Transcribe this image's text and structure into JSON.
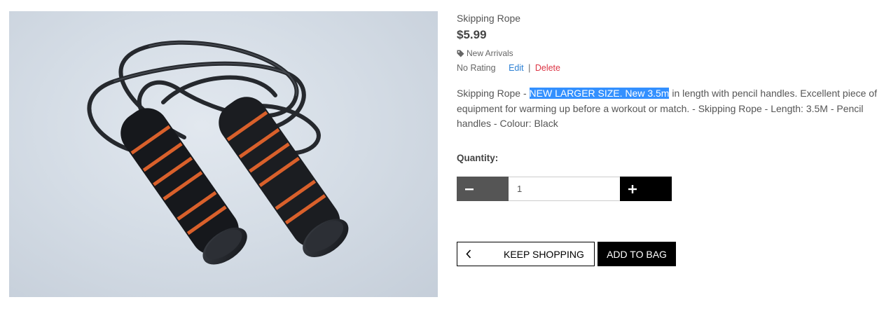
{
  "product": {
    "name": "Skipping Rope",
    "price": "$5.99",
    "category": "New Arrivals",
    "rating": "No Rating",
    "edit_label": "Edit",
    "separator": "|",
    "delete_label": "Delete",
    "description_before": "Skipping Rope - ",
    "description_highlight": "NEW LARGER SIZE. New 3.5m",
    "description_after": " in length with pencil handles. Excellent piece of equipment for warming up before a workout or match. - Skipping Rope - Length: 3.5M - Pencil handles - Colour: Black"
  },
  "quantity": {
    "label": "Quantity:",
    "value": "1"
  },
  "actions": {
    "keep_shopping": "KEEP SHOPPING",
    "add_to_bag": "ADD TO BAG"
  },
  "icons": {
    "tag": "tag-icon",
    "minus": "minus-icon",
    "plus": "plus-icon",
    "back": "chevron-left-icon"
  },
  "colors": {
    "link": "#2a7fd4",
    "delete": "#dc3545",
    "highlight": "#3390ff",
    "minus_button": "#555555",
    "plus_button": "#000000"
  }
}
